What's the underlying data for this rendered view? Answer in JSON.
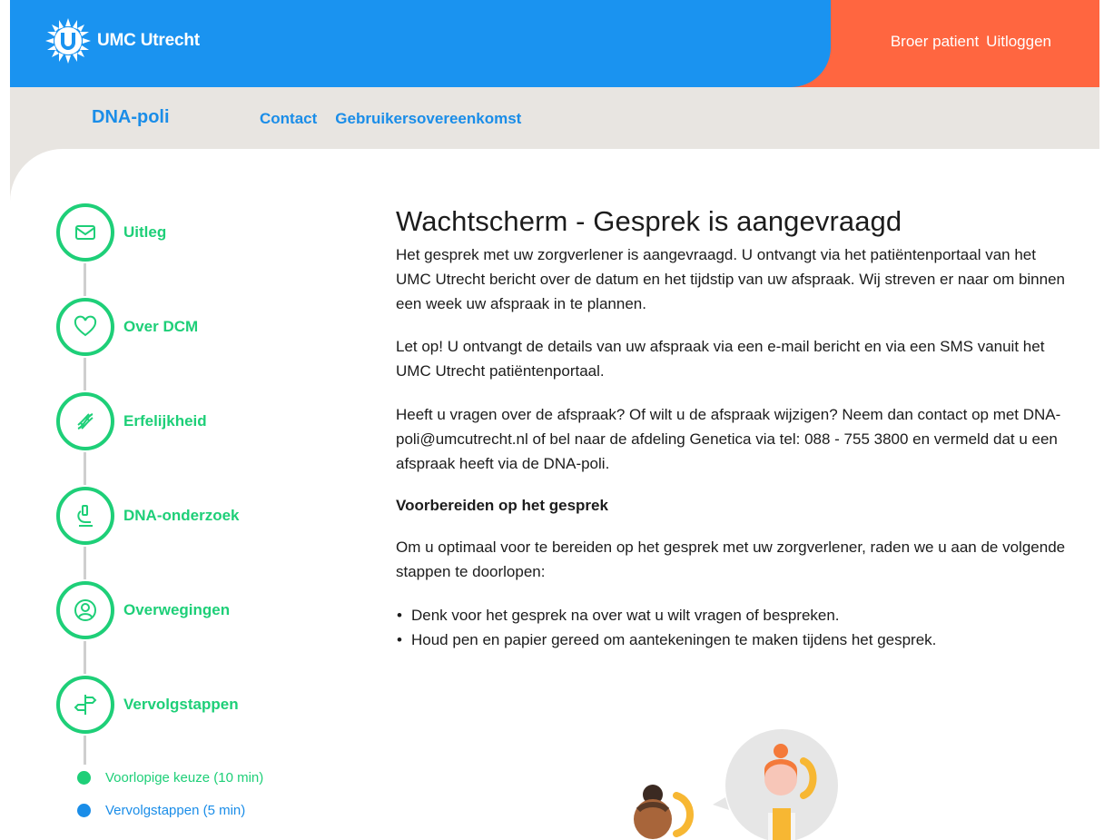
{
  "header": {
    "logo_text": "UMC Utrecht",
    "user_name": "Broer patient",
    "logout": "Uitloggen"
  },
  "subnav": {
    "poli_name": "DNA-poli",
    "links": [
      "Contact",
      "Gebruikersovereenkomst"
    ]
  },
  "sidebar": {
    "steps": [
      {
        "label": "Uitleg",
        "icon": "envelope-icon"
      },
      {
        "label": "Over DCM",
        "icon": "heart-icon"
      },
      {
        "label": "Erfelijkheid",
        "icon": "dna-icon"
      },
      {
        "label": "DNA-onderzoek",
        "icon": "microscope-icon"
      },
      {
        "label": "Overwegingen",
        "icon": "person-icon"
      },
      {
        "label": "Vervolgstappen",
        "icon": "signpost-icon"
      }
    ],
    "substeps": [
      {
        "label": "Voorlopige keuze (10 min)",
        "color": "#1ecf78"
      },
      {
        "label": "Vervolgstappen (5 min)",
        "color": "#1a8de8"
      }
    ]
  },
  "main": {
    "title": "Wachtscherm - Gesprek is aangevraagd",
    "p1": "Het gesprek met uw zorgverlener is aangevraagd. U ontvangt via het patiëntenportaal van het UMC Utrecht bericht over de datum en het tijdstip van uw afspraak. Wij streven er naar om binnen een week uw afspraak in te plannen.",
    "p2": "Let op! U ontvangt de details van uw afspraak via een e-mail bericht en via een SMS vanuit het UMC Utrecht patiëntenportaal.",
    "p3": "Heeft u vragen over de afspraak? Of wilt u de afspraak wijzigen? Neem dan contact op met DNA-poli@umcutrecht.nl of bel naar de afdeling Genetica via tel: 088 - 755 3800 en vermeld dat u een afspraak heeft via de DNA-poli.",
    "subheading": "Voorbereiden op het gesprek",
    "p4": "Om u optimaal voor te bereiden op het gesprek met uw zorgverlener, raden we u aan de volgende stappen te doorlopen:",
    "bullets": [
      "Denk voor het gesprek na over wat u wilt vragen of bespreken.",
      "Houd pen en papier gereed om aantekeningen te maken tijdens het gesprek."
    ]
  },
  "colors": {
    "header_blue": "#1a93f0",
    "header_orange": "#ff6640",
    "accent_green": "#1ecf78",
    "link_blue": "#1a8de8",
    "subnav_bg": "#e8e5e1"
  }
}
